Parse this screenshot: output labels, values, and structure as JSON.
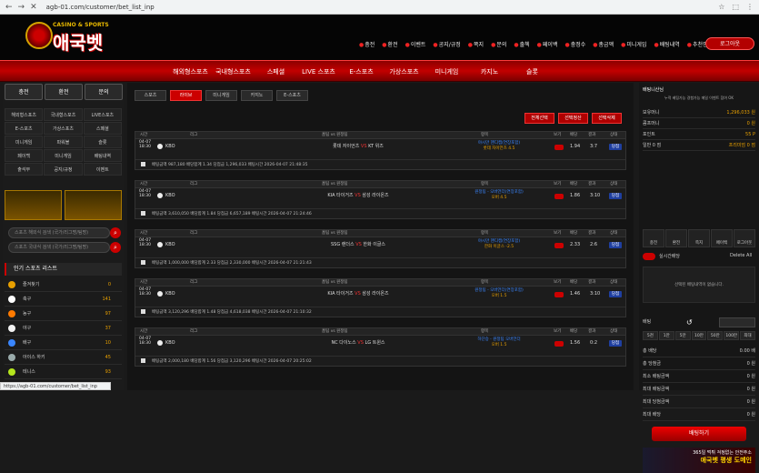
{
  "browser": {
    "url": "agb-01.com/customer/bet_list_inp",
    "status_url": "https://agb-01.com/customer/bet_list_inp"
  },
  "brand": {
    "tagline": "CASINO & SPORTS",
    "name": "애국벳"
  },
  "topmenu": [
    "충전",
    "환전",
    "이벤트",
    "공지/규정",
    "쪽지",
    "문의",
    "출첵",
    "페이백",
    "충정수",
    "총금액",
    "미니게임",
    "배팅내역",
    "추천인"
  ],
  "logout_label": "로그아웃",
  "mainnav": [
    "해외형스포츠",
    "국내형스포츠",
    "스페셜",
    "LIVE 스포츠",
    "E-스포츠",
    "가상스포츠",
    "미니게임",
    "카지노",
    "슬롯"
  ],
  "left": {
    "quick": [
      "충전",
      "환전",
      "문의"
    ],
    "grid": [
      "해외형스포츠",
      "국내형스포츠",
      "LIVE스포츠",
      "E-스포츠",
      "가상스포츠",
      "스페셜",
      "미니게임",
      "파워볼",
      "슬롯",
      "페이백",
      "미니게임",
      "배팅내역",
      "출석부",
      "공지/규정",
      "이벤트"
    ],
    "search1": "스포츠 해외식 검색 (국가/리그명/팀명)",
    "search2": "스포츠 국내식 검색 (국가/리그명/팀명)",
    "popular_title": "인기 스포츠 리스트",
    "sports": [
      {
        "name": "즐겨찾기",
        "count": "0",
        "color": "#e8a000"
      },
      {
        "name": "축구",
        "count": "141",
        "color": "#ffffff"
      },
      {
        "name": "농구",
        "count": "97",
        "color": "#ff7a00"
      },
      {
        "name": "야구",
        "count": "37",
        "color": "#f2f2f2"
      },
      {
        "name": "배구",
        "count": "10",
        "color": "#3a86ff"
      },
      {
        "name": "아이스 하키",
        "count": "45",
        "color": "#9aa"
      },
      {
        "name": "테니스",
        "count": "93",
        "color": "#b5e61d"
      }
    ]
  },
  "tabs": [
    "스포츠",
    "라이브",
    "미니게임",
    "카지노",
    "E-스포츠"
  ],
  "actions": [
    "전체선택",
    "선택정산",
    "선택삭제"
  ],
  "table_headers": [
    "시간",
    "리그",
    "홈팀 vs 원정팀",
    "항목",
    "보기",
    "배당",
    "결과",
    "상태"
  ],
  "bets": [
    {
      "date": "04-07",
      "time": "18:30",
      "league": "KBO",
      "home": "롯데 자이언츠",
      "away": "KT 위즈",
      "pick1": "야시만 핸디캡(연장포함)",
      "pick2": "롯데 자이언츠 4.5",
      "odds": "1.94",
      "result": "3:7",
      "status": "당첨",
      "footer": "배팅금액 987,180 배당합계 1.34 당첨금 1,296,033 배팅시간 2026-04-07 21:48:35"
    },
    {
      "date": "04-07",
      "time": "18:30",
      "league": "KBO",
      "home": "KIA 타이거즈",
      "away": "삼성 라이온즈",
      "pick1": "원정팀 - 오버언더(연장포함)",
      "pick2": "오버 4.5",
      "odds": "1.86",
      "result": "3:10",
      "status": "당첨",
      "footer": "배팅금액 3,610,050 배당합계 1.84 당첨금 6,657,189 배팅시간 2026-04-07 21:24:46"
    },
    {
      "date": "04-07",
      "time": "18:30",
      "league": "KBO",
      "home": "SSG 랜더스",
      "away": "한화 이글스",
      "pick1": "야시만 핸디캡(연장포함)",
      "pick2": "한화 이글스 -2.5",
      "odds": "2.33",
      "result": "2:6",
      "status": "당첨",
      "footer": "배팅금액 1,000,000 배당합계 2.33 당첨금 2,330,000 배팅시간 2026-04-07 21:21:43"
    },
    {
      "date": "04-07",
      "time": "18:30",
      "league": "KBO",
      "home": "KIA 타이거즈",
      "away": "삼성 라이온즈",
      "pick1": "원정팀 - 오버언더(연장포함)",
      "pick2": "오버 1.5",
      "odds": "1.46",
      "result": "3:10",
      "status": "당첨",
      "footer": "배팅금액 3,120,296 배당합계 1.48 당첨금 4,618,038 배팅시간 2026-04-07 21:10:32"
    },
    {
      "date": "04-07",
      "time": "18:30",
      "league": "KBO",
      "home": "NC 다이노스",
      "away": "LG 트윈스",
      "pick1": "하단승 - 원정팀 오버언더",
      "pick2": "오버 1.5",
      "odds": "1.56",
      "result": "0:2",
      "status": "당첨",
      "footer": "배팅금액 2,000,180 배당합계 1.56 당첨금 3,120,296 배팅시간 2026-04-07 20:25:02"
    }
  ],
  "right": {
    "user": "배팅니산님",
    "notice": "누적 베팅가능 경험가능 메일 이벤트 참여 OK",
    "rows": [
      {
        "label": "보유머니",
        "value": "1,296,033 원"
      },
      {
        "label": "콤프머니",
        "value": "0 원"
      },
      {
        "label": "포인트",
        "value": "55 P"
      },
      {
        "label": "일반 0 점",
        "value": "프리미엄 0 점"
      }
    ],
    "buttons": [
      "충전",
      "환전",
      "쪽지",
      "페이백",
      "로그아웃"
    ],
    "toggle_label": "실시간배당",
    "delete_all": "Delete All",
    "slip_empty": "선택된 배팅내역이 없습니다.",
    "amount_label": "배팅",
    "chips": [
      "5천",
      "1만",
      "5만",
      "10만",
      "50만",
      "100만",
      "최대"
    ],
    "summary": [
      {
        "label": "총 배당",
        "value": "0.00 배"
      },
      {
        "label": "총 당첨금",
        "value": "0 원"
      },
      {
        "label": "최소 배팅금액",
        "value": "0 원"
      },
      {
        "label": "최대 배팅금액",
        "value": "0 원"
      },
      {
        "label": "최대 당첨금액",
        "value": "0 원"
      },
      {
        "label": "최대 배당",
        "value": "0 원"
      }
    ],
    "bet_button": "배팅하기",
    "promo1": "365일 먹튀 걱정없는 안전주소",
    "promo2": "애국벳 평생 도메인"
  }
}
